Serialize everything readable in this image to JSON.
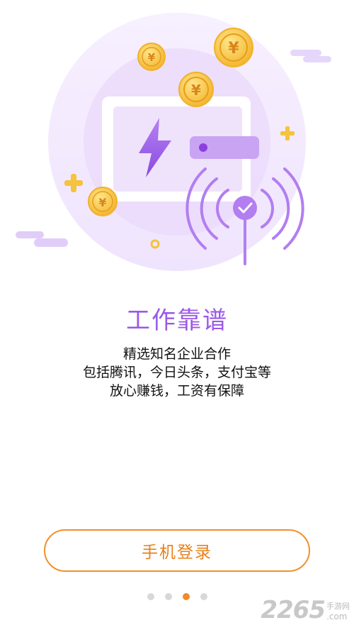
{
  "onboarding": {
    "title": "工作靠谱",
    "lines": [
      "精选知名企业合作",
      "包括腾讯，今日头条，支付宝等",
      "放心赚钱，工资有保障"
    ],
    "login_button": "手机登录",
    "page_indicator": {
      "count": 4,
      "active_index": 2
    }
  },
  "watermark": {
    "number": "2265",
    "site": "手游网",
    "suffix": ".com"
  },
  "colors": {
    "accent_purple": "#9a5ae6",
    "accent_orange": "#f08a2a",
    "coin": "#f5c33c"
  },
  "icons": [
    "lightning-icon",
    "yuan-coin-icon",
    "signal-check-icon",
    "plus-sparkle-icon"
  ]
}
